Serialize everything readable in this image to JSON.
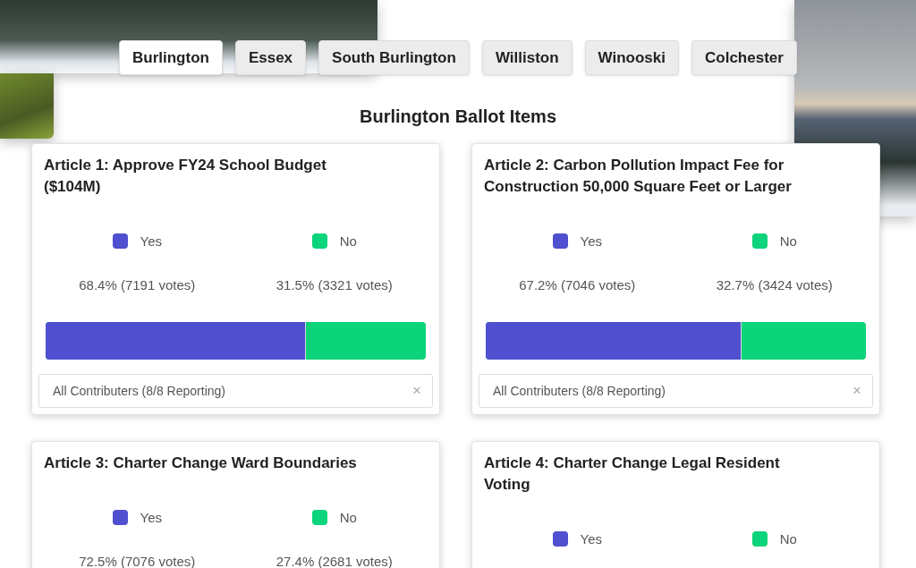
{
  "tabs": [
    {
      "label": "Burlington",
      "selected": true
    },
    {
      "label": "Essex",
      "selected": false
    },
    {
      "label": "South Burlington",
      "selected": false
    },
    {
      "label": "Williston",
      "selected": false
    },
    {
      "label": "Winooski",
      "selected": false
    },
    {
      "label": "Colchester",
      "selected": false
    }
  ],
  "heading": "Burlington Ballot Items",
  "articles": [
    {
      "title": "Article 1: Approve FY24 School Budget ($104M)",
      "options": [
        {
          "label": "Yes",
          "color": "#4f4fcf",
          "result": "68.4% (7191 votes)"
        },
        {
          "label": "No",
          "color": "#0bd47a",
          "result": "31.5% (3321 votes)"
        }
      ],
      "level": 0.685,
      "filter": {
        "value": "All Contributers (8/8 Reporting)",
        "clear": "×"
      }
    },
    {
      "title": "Article 2: Carbon Pollution Impact Fee for Construction 50,000 Square Feet or Larger",
      "options": [
        {
          "label": "Yes",
          "color": "#4f4fcf",
          "result": "67.2% (7046 votes)"
        },
        {
          "label": "No",
          "color": "#0bd47a",
          "result": "32.7% (3424 votes)"
        }
      ],
      "level": 0.672,
      "filter": {
        "value": "All Contributers (8/8 Reporting)",
        "clear": "×"
      }
    },
    {
      "title": "Article 3: Charter Change Ward Boundaries",
      "options": [
        {
          "label": "Yes",
          "color": "#4f4fcf",
          "result": "72.5% (7076 votes)"
        },
        {
          "label": "No",
          "color": "#0bd47a",
          "result": "27.4% (2681 votes)"
        }
      ]
    },
    {
      "title": "Article 4: Charter Change Legal Resident Voting",
      "options": [
        {
          "label": "Yes",
          "color": "#4f4fcf"
        },
        {
          "label": "No",
          "color": "#0bd47a"
        }
      ]
    }
  ]
}
